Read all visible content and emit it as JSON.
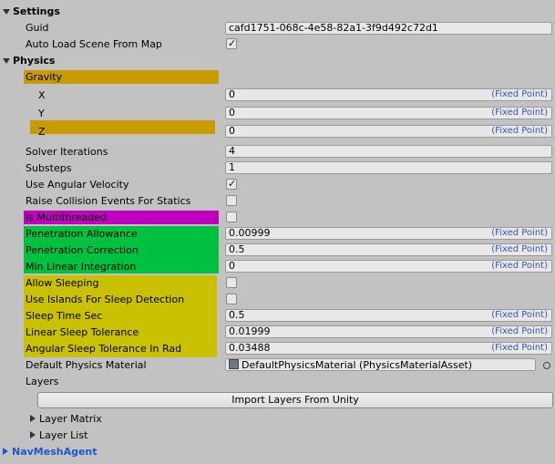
{
  "settings": {
    "header": "Settings",
    "guid_label": "Guid",
    "guid_value": "cafd1751-068c-4e58-82a1-3f9d492c72d1",
    "auto_load_label": "Auto Load Scene From Map",
    "auto_load_checked": true
  },
  "physics": {
    "header": "Physics",
    "gravity_label": "Gravity",
    "gravity": {
      "x_label": "X",
      "x_value": "0",
      "y_label": "Y",
      "y_value": "0",
      "z_label": "Z",
      "z_value": "0"
    },
    "fixed_point_label": "(Fixed Point)",
    "solver_iterations_label": "Solver Iterations",
    "solver_iterations_value": "4",
    "substeps_label": "Substeps",
    "substeps_value": "1",
    "use_angular_velocity_label": "Use Angular Velocity",
    "use_angular_velocity_checked": true,
    "raise_collision_label": "Raise Collision Events For Statics",
    "raise_collision_checked": false,
    "is_multithreaded_label": "Is Multithreaded",
    "is_multithreaded_checked": false,
    "penetration_allowance_label": "Penetration Allowance",
    "penetration_allowance_value": "0.00999",
    "penetration_correction_label": "Penetration Correction",
    "penetration_correction_value": "0.5",
    "min_linear_integration_label": "Min Linear Integration",
    "min_linear_integration_value": "0",
    "allow_sleeping_label": "Allow Sleeping",
    "allow_sleeping_checked": false,
    "use_islands_label": "Use Islands For Sleep Detection",
    "use_islands_checked": false,
    "sleep_time_label": "Sleep Time Sec",
    "sleep_time_value": "0.5",
    "linear_sleep_label": "Linear Sleep Tolerance",
    "linear_sleep_value": "0.01999",
    "angular_sleep_label": "Angular Sleep Tolerance In Rad",
    "angular_sleep_value": "0.03488",
    "default_material_label": "Default Physics Material",
    "default_material_value": "DefaultPhysicsMaterial (PhysicsMaterialAsset)",
    "layers_label": "Layers",
    "import_layers_button": "Import Layers From Unity",
    "layer_matrix_label": "Layer Matrix",
    "layer_list_label": "Layer List"
  },
  "navmesh": {
    "header": "NavMeshAgent"
  },
  "colors": {
    "gold": "#c79c00",
    "magenta": "#c000c0",
    "green": "#00c040",
    "yellow": "#c8c000",
    "fixed_point": "#3a55b0",
    "navmesh_header": "#1e58c8"
  },
  "icons": {
    "foldout_open": "triangle-down-icon",
    "foldout_closed": "triangle-right-icon",
    "checkmark": "checkmark-icon",
    "object_picker": "object-picker-icon",
    "asset": "asset-icon"
  }
}
